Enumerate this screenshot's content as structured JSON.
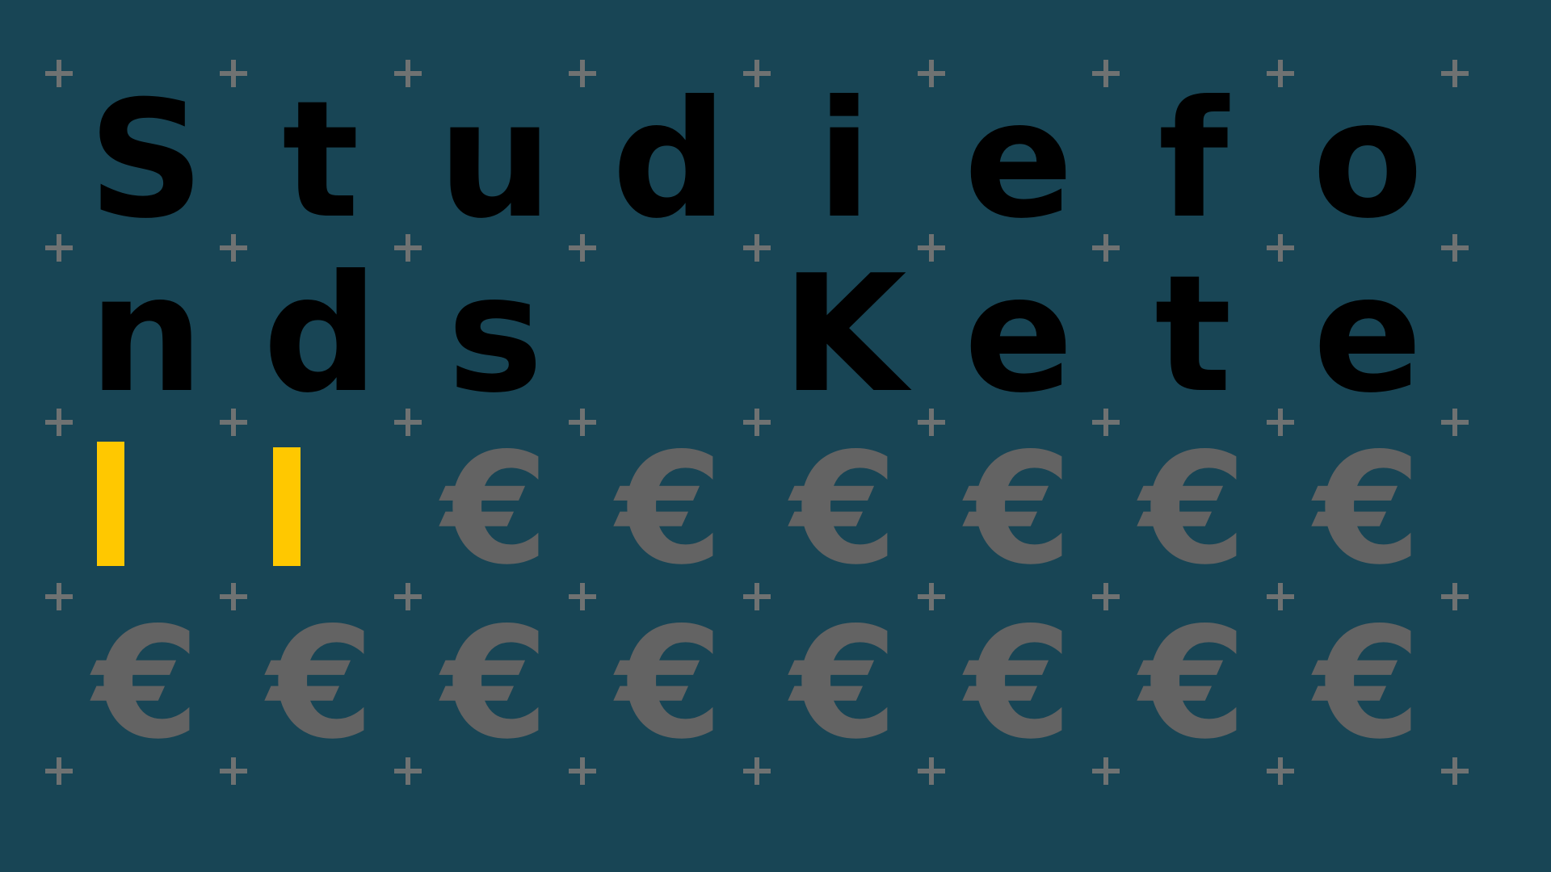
{
  "title_line_1": [
    "S",
    "t",
    "u",
    "d",
    "i",
    "e",
    "f",
    "o"
  ],
  "title_line_2": [
    "n",
    "d",
    "s",
    "",
    "K",
    "e",
    "t",
    "e"
  ],
  "progress": {
    "filled_slots": 2,
    "total_slots": 16,
    "slot_symbol": "€"
  },
  "colors": {
    "background": "#184555",
    "letters": "#000000",
    "euro": "#636363",
    "plus": "#6f7272",
    "progress_bar": "#ffc800"
  },
  "icons": {
    "grid_marker": "plus-icon",
    "slot": "euro-sign-icon",
    "filled_slot": "yellow-bar-marker"
  }
}
